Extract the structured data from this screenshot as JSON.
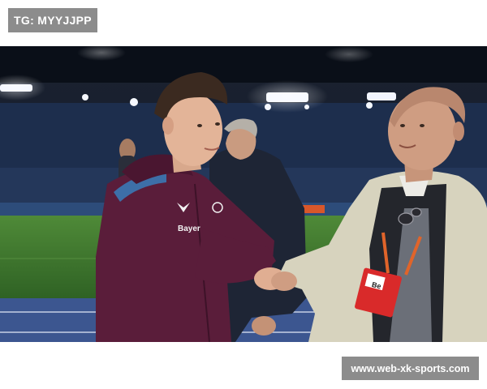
{
  "header": {
    "tag_text": "TG: MYYJJPP"
  },
  "photo": {
    "jacket_brand_text": "Bayer",
    "badge_text": "Be",
    "colors": {
      "stadium_dark": "#0e1522",
      "pitch_green": "#3f7a2e",
      "jacket_maroon": "#5a1d3a",
      "trench_beige": "#d7d3be",
      "lanyard_orange": "#e0642a",
      "badge_red": "#d92a2a"
    }
  },
  "footer": {
    "watermark_text": "www.web-xk-sports.com"
  }
}
